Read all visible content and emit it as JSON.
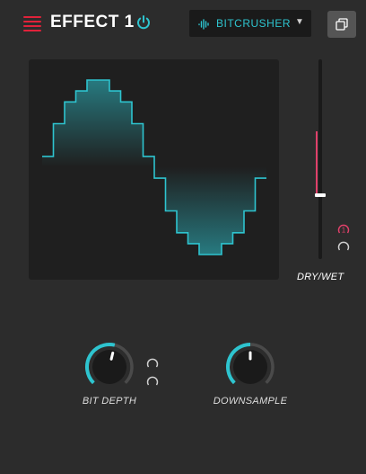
{
  "header": {
    "title": "EFFECT 1",
    "menu_icon": "hamburger-menu-icon",
    "power_icon": "power-icon",
    "copy_icon": "copy-icon"
  },
  "effect_selector": {
    "value": "BITCRUSHER",
    "icon": "waveform-icon"
  },
  "colors": {
    "accent_cyan": "#2ec4cf",
    "accent_red": "#e0223a",
    "drywet_pink": "#e0406a",
    "background": "#2c2c2c",
    "display_bg": "#1f1f1f"
  },
  "display": {
    "type": "bitcrushed-sine-wave",
    "quantization_steps": 8
  },
  "dry_wet": {
    "label": "DRY/WET",
    "value_fraction": 0.32,
    "mod_slots": [
      {
        "number": "1",
        "active": true
      },
      {
        "number": "",
        "active": false
      }
    ]
  },
  "knobs": [
    {
      "id": "bit-depth",
      "label": "BIT DEPTH",
      "value_fraction": 0.55,
      "mod_slots": 2
    },
    {
      "id": "downsample",
      "label": "DOWNSAMPLE",
      "value_fraction": 0.5,
      "mod_slots": 0
    }
  ]
}
